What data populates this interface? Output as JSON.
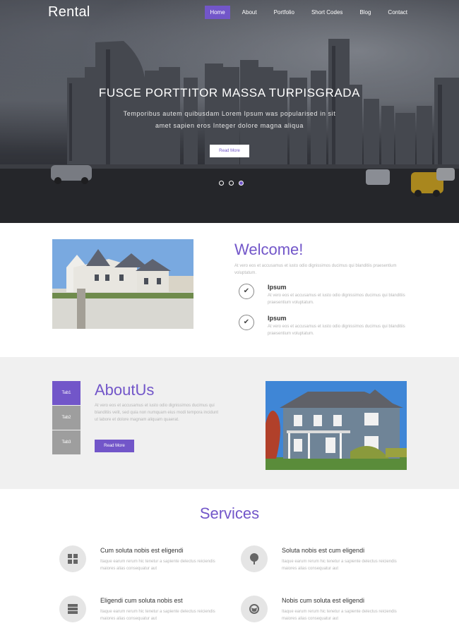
{
  "header": {
    "logo": "Rental",
    "nav": [
      "Home",
      "About",
      "Portfolio",
      "Short Codes",
      "Blog",
      "Contact"
    ],
    "active_nav": "Home"
  },
  "hero": {
    "title": "FUSCE PORTTITOR MASSA TURPISGRADA",
    "subtitle": "Temporibus autem quibusdam Lorem Ipsum was popularised in sit amet sapien eros Integer dolore magna aliqua",
    "button": "Read More",
    "slides": 3,
    "active_slide": 3
  },
  "welcome": {
    "title": "Welcome!",
    "text": "At vero eos et accusamus et iusto odio dignissimos ducimus qui blanditiis praesentium voluptatum.",
    "features": [
      {
        "title": "Ipsum",
        "text": "At vero eos et accusamus et iusto odio dignissimos ducimus qui blanditiis praesentium voluptatum."
      },
      {
        "title": "Ipsum",
        "text": "At vero eos et accusamus et iusto odio dignissimos ducimus qui blanditiis praesentium voluptatum."
      }
    ]
  },
  "about": {
    "tabs": [
      "Tab1",
      "Tab2",
      "Tab3"
    ],
    "title": "AboutUs",
    "text": "At vero eos et accusamus et iusto odio dignissimos ducimus qui blanditiis velit, sed quia non numquam eius modi tempora incidunt ut labore et dolore magnam aliquam quaerat.",
    "button": "Read More"
  },
  "services": {
    "title": "Services",
    "items": [
      {
        "icon": "grid-icon",
        "title": "Cum soluta nobis est eligendi",
        "text": "Itaque earum rerum hic tenetur a sapiente delectus reiciendis maiores alias consequatur aut"
      },
      {
        "icon": "tree-icon",
        "title": "Soluta nobis est cum eligendi",
        "text": "Itaque earum rerum hic tenetur a sapiente delectus reiciendis maiores alias consequatur aut"
      },
      {
        "icon": "server-icon",
        "title": "Eligendi cum soluta nobis est",
        "text": "Itaque earum rerum hic tenetur a sapiente delectus reiciendis maiores alias consequatur aut"
      },
      {
        "icon": "globe-icon",
        "title": "Nobis cum soluta est eligendi",
        "text": "Itaque earum rerum hic tenetur a sapiente delectus reiciendis maiores alias consequatur aut"
      }
    ]
  },
  "colors": {
    "accent": "#7256c9",
    "light_bg": "#f0f0f0",
    "muted_text": "#b5b5b5"
  }
}
